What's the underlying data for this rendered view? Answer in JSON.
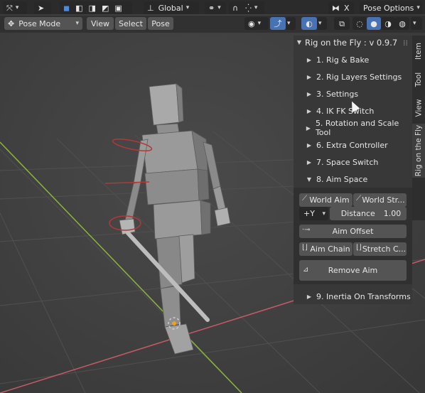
{
  "topbar": {
    "transform_orientation": "Global",
    "pose_options": "Pose Options",
    "x_label": "X"
  },
  "header": {
    "mode": "Pose Mode",
    "menus": [
      "View",
      "Select",
      "Pose"
    ]
  },
  "panel": {
    "title": "Rig on the Fly : v 0.9.7",
    "sections": [
      "1. Rig & Bake",
      "2. Rig Layers Settings",
      "3. Settings",
      "4. IK FK Switch",
      "5. Rotation and Scale Tool",
      "6. Extra Controller",
      "7. Space Switch",
      "8. Aim Space"
    ],
    "aim_space": {
      "world_aim": "World Aim",
      "world_stretch": "World Str...",
      "axis": "+Y",
      "distance_label": "Distance",
      "distance_value": "1.00",
      "aim_offset": "Aim Offset",
      "aim_chain": "Aim Chain",
      "stretch_chain": "Stretch C...",
      "remove_aim": "Remove Aim"
    },
    "last_section": "9. Inertia On Transforms"
  },
  "tabs": [
    "Item",
    "Tool",
    "View",
    "Rig on the Fly"
  ],
  "colors": {
    "background": "#3d3d3d",
    "x_axis": "#c75a68",
    "y_axis": "#8db33d",
    "panel": "#383838",
    "button": "#545454",
    "accent": "#4772b3"
  }
}
